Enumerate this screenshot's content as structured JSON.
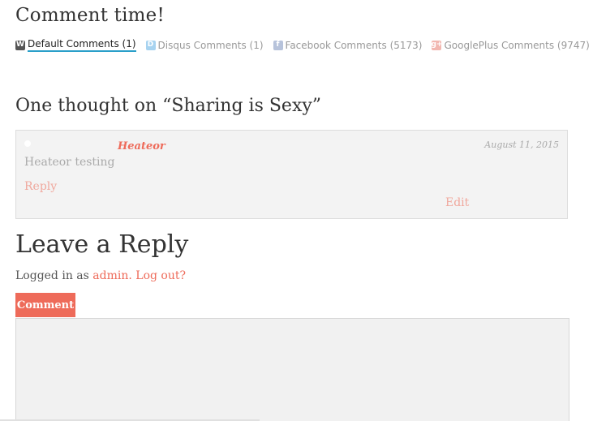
{
  "header": {
    "title": "Comment time!"
  },
  "tabs": [
    {
      "label": "Default Comments (1)",
      "icon": "wordpress-icon",
      "glyph": "W"
    },
    {
      "label": "Disqus Comments (1)",
      "icon": "disqus-icon",
      "glyph": "D"
    },
    {
      "label": "Facebook Comments (5173)",
      "icon": "facebook-icon",
      "glyph": "f"
    },
    {
      "label": "GooglePlus Comments (9747)",
      "icon": "googleplus-icon",
      "glyph": "g+"
    }
  ],
  "thoughts_title": "One thought on “Sharing is Sexy”",
  "comment": {
    "author": "Heateor",
    "date": "August 11, 2015",
    "text": "Heateor testing",
    "reply_label": "Reply",
    "edit_label": "Edit"
  },
  "reply_section": {
    "title": "Leave a Reply",
    "logged_in_prefix": "Logged in as ",
    "user": "admin",
    "separator": ". ",
    "logout_label": "Log out?",
    "comment_label": "Comment"
  },
  "colors": {
    "accent": "#ee6b5a",
    "active_tab_underline": "#2a9fc9"
  }
}
